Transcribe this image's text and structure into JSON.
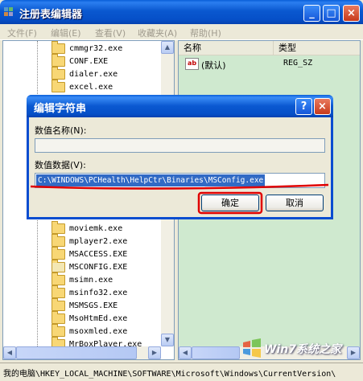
{
  "window": {
    "title": "注册表编辑器"
  },
  "menu": [
    {
      "label": "文件(F)"
    },
    {
      "label": "编辑(E)"
    },
    {
      "label": "查看(V)"
    },
    {
      "label": "收藏夹(A)"
    },
    {
      "label": "帮助(H)"
    }
  ],
  "tree_top": [
    "cmmgr32.exe",
    "CONF.EXE",
    "dialer.exe",
    "excel.exe"
  ],
  "tree_bottom": [
    "moviemk.exe",
    "mplayer2.exe",
    "MSACCESS.EXE",
    "MSCONFIG.EXE",
    "msimn.exe",
    "msinfo32.exe",
    "MSMSGS.EXE",
    "MsoHtmEd.exe",
    "msoxmled.exe",
    "MrBoxPlayer.exe"
  ],
  "list": {
    "headers": {
      "name": "名称",
      "type": "类型"
    },
    "rows": [
      {
        "name": "(默认)",
        "type": "REG_SZ",
        "icon": "ab-string-icon"
      }
    ]
  },
  "dialog": {
    "title": "编辑字符串",
    "name_label": "数值名称(N):",
    "name_value": "",
    "data_label": "数值数据(V):",
    "data_value": "C:\\WINDOWS\\PCHealth\\HelpCtr\\Binaries\\MSConfig.exe",
    "ok_label": "确定",
    "cancel_label": "取消",
    "help_btn": "?",
    "close_btn": "×"
  },
  "statusbar": {
    "path": "我的电脑\\HKEY_LOCAL_MACHINE\\SOFTWARE\\Microsoft\\Windows\\CurrentVersion\\"
  },
  "watermark": "Win7系统之家",
  "colors": {
    "highlight": "#316AC5",
    "annotation": "#E00000",
    "titlebar": "#0A58D0"
  }
}
